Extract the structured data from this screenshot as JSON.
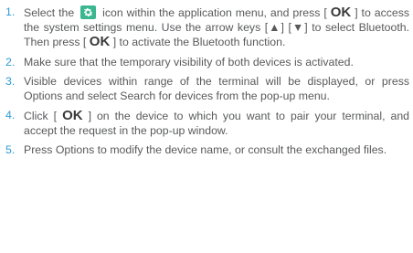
{
  "steps": [
    {
      "number": "1.",
      "t1": "Select the",
      "icon": "settings-gear-icon",
      "t2": "icon within the application menu, and press [",
      "ok1": "OK",
      "t3": "] to access the system settings menu. Use the arrow keys [",
      "up": "▲",
      "t4": "] [",
      "down": "▼",
      "t5": "] to select Bluetooth. Then press [",
      "ok2": "OK",
      "t6": "] to activate the Bluetooth function."
    },
    {
      "number": "2.",
      "text": "Make sure that the temporary visibility of both devices is activated."
    },
    {
      "number": "3.",
      "text": "Visible devices within range of the terminal will be displayed, or press Options and select Search for devices from the pop-up menu."
    },
    {
      "number": "4.",
      "t1": "Click [",
      "ok": "OK",
      "t2": "] on the device to which you want to pair your terminal, and accept the request in the pop-up window."
    },
    {
      "number": "5.",
      "text": "Press Options to modify the device name, or consult the exchanged files."
    }
  ],
  "colors": {
    "number": "#2f9ad6",
    "text": "#58595b",
    "icon_bg": "#3bb78f"
  }
}
